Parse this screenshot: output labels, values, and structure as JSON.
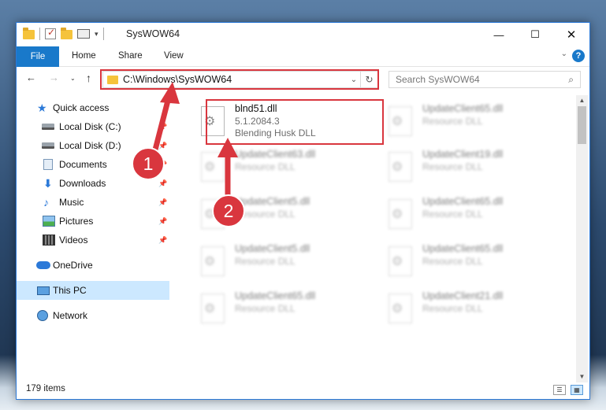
{
  "window": {
    "title": "SysWOW64",
    "controls": {
      "minimize": "—",
      "maximize": "☐",
      "close": "✕"
    }
  },
  "ribbon": {
    "tabs": [
      {
        "label": "File"
      },
      {
        "label": "Home"
      },
      {
        "label": "Share"
      },
      {
        "label": "View"
      }
    ],
    "expand_icon": "⌄",
    "help_icon": "?"
  },
  "navigation": {
    "back_icon": "←",
    "forward_icon": "→",
    "recent_icon": "⌄",
    "up_icon": "↑",
    "address": "C:\\Windows\\SysWOW64",
    "address_dropdown_icon": "⌄",
    "refresh_icon": "↻",
    "search_placeholder": "Search SysWOW64",
    "search_icon": "⌕"
  },
  "sidebar": {
    "pin_icon": "📌",
    "items": [
      {
        "label": "Quick access",
        "icon": "star-icon"
      },
      {
        "label": "Local Disk (C:)",
        "icon": "drive-icon",
        "pinned": true
      },
      {
        "label": "Local Disk (D:)",
        "icon": "drive-icon",
        "pinned": true
      },
      {
        "label": "Documents",
        "icon": "documents-icon",
        "pinned": true
      },
      {
        "label": "Downloads",
        "icon": "download-icon",
        "pinned": true
      },
      {
        "label": "Music",
        "icon": "music-icon",
        "pinned": true
      },
      {
        "label": "Pictures",
        "icon": "pictures-icon",
        "pinned": true
      },
      {
        "label": "Videos",
        "icon": "videos-icon",
        "pinned": true
      },
      {
        "label": "OneDrive",
        "icon": "cloud-icon"
      },
      {
        "label": "This PC",
        "icon": "computer-icon",
        "selected": true
      },
      {
        "label": "Network",
        "icon": "network-icon"
      }
    ]
  },
  "files": [
    {
      "name": "blnd51.dll",
      "version": "5.1.2084.3",
      "description": "Blending Husk DLL",
      "highlighted": true
    },
    {
      "name": "UpdateClient65.dll",
      "version": "",
      "description": "Resource DLL"
    },
    {
      "name": "UpdateClient63.dll",
      "version": "",
      "description": "Resource DLL"
    },
    {
      "name": "UpdateClient19.dll",
      "version": "",
      "description": "Resource DLL"
    },
    {
      "name": "UpdateClient5.dll",
      "version": "",
      "description": "Resource DLL"
    },
    {
      "name": "UpdateClient65.dll",
      "version": "",
      "description": "Resource DLL"
    },
    {
      "name": "UpdateClient5.dll",
      "version": "",
      "description": "Resource DLL"
    },
    {
      "name": "UpdateClient65.dll",
      "version": "",
      "description": "Resource DLL"
    },
    {
      "name": "UpdateClient65.dll",
      "version": "",
      "description": "Resource DLL"
    },
    {
      "name": "UpdateClient21.dll",
      "version": "",
      "description": "Resource DLL"
    }
  ],
  "status": {
    "item_count": "179 items"
  },
  "annotations": {
    "callout_1": "1",
    "callout_2": "2",
    "color": "#d9363e"
  }
}
